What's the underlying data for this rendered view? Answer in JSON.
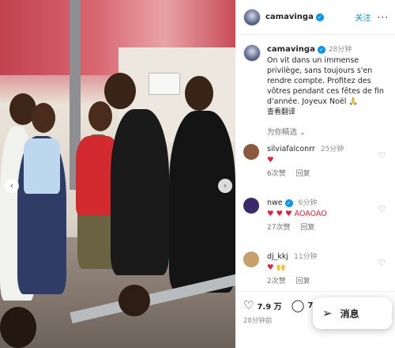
{
  "header": {
    "username": "camavinga",
    "follow_label": "关注",
    "more_label": "···"
  },
  "photo": {
    "prev_label": "‹",
    "next_label": "›"
  },
  "caption": {
    "username": "camavinga",
    "time": "28分钟",
    "text": "On vit dans un immense privilège, sans toujours s'en rendre compte. Profitez des vôtres pendant ces fêtes de fin d'année. Joyeux Noël 🙏",
    "translate_label": "查看翻译"
  },
  "pick_label": "为你精选 ⌄",
  "comments": [
    {
      "user": "silviafalconrr",
      "time": "25分钟",
      "text": "♥",
      "likes": "6次赞",
      "reply": "回复",
      "avatar_color": "#8b5a3c"
    },
    {
      "user": "nwe",
      "time": "6分钟",
      "text": "♥ ♥ ♥ AOAOAO",
      "likes": "27次赞",
      "reply": "回复",
      "avatar_color": "#3b2a6b"
    },
    {
      "user": "dj_kkj",
      "time": "11分钟",
      "text": "♥ 🙌",
      "likes": "2次赞",
      "reply": "回复",
      "avatar_color": "#c8a06a"
    }
  ],
  "actions": {
    "like_count": "7.9 万",
    "comment_count": "776",
    "posted": "28分钟前"
  },
  "message": {
    "label": "消息"
  },
  "colors": {
    "accent": "#0095f6",
    "heart": "#ed1c3b"
  }
}
